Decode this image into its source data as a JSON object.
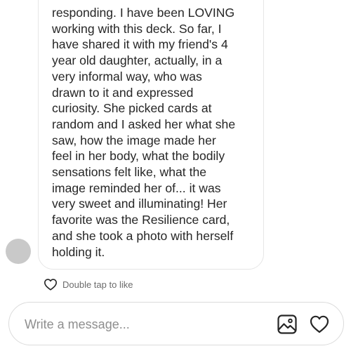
{
  "message": {
    "lines": [
      "responding. I have been LOVING",
      "working with this deck. So far, I",
      "have shared it with my friend's 4",
      "year old daughter, actually, in a",
      "very informal way, who was",
      "drawn to it and expressed",
      "curiosity. She picked cards at",
      "random and I asked her what she",
      "saw, how the image made her",
      "feel in her body, what the bodily",
      "sensations felt like, what the",
      "image reminded her of... it was",
      "very sweet and illuminating! Her",
      "favorite was the Resilience card,",
      "and she took a photo with herself",
      "holding it."
    ],
    "like_hint": "Double tap to like",
    "like_icon": "heart-outline-icon"
  },
  "composer": {
    "placeholder": "Write a message...",
    "value": "",
    "gallery_icon": "gallery-icon",
    "heart_icon": "heart-icon"
  },
  "colors": {
    "text": "#262626",
    "muted": "#6b6b6b",
    "placeholder": "#8e8e8e",
    "border": "#dbdbdb",
    "avatar": "#c9c9c9"
  }
}
